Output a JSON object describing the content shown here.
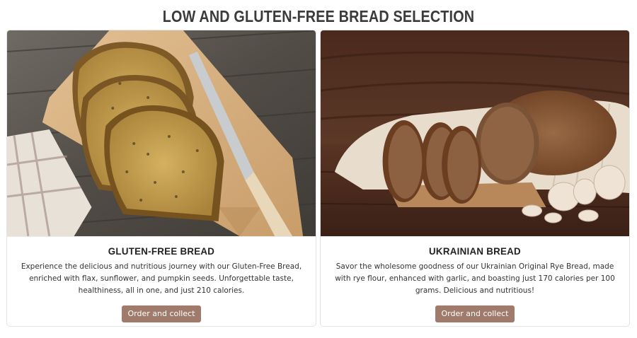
{
  "page": {
    "title": "LOW AND GLUTEN-FREE BREAD SELECTION"
  },
  "products": [
    {
      "name": "GLUTEN-FREE BREAD",
      "description": "Experience the delicious and nutritious journey with our Gluten-Free Bread, enriched with flax, sunflower, and pumpkin seeds. Unforgettable taste, healthiness, all in one, and just 210 calories.",
      "button_label": "Order and collect",
      "image_icon": "seeded-bread-on-board-photo"
    },
    {
      "name": "UKRAINIAN BREAD",
      "description": "Savor the wholesome goodness of our Ukrainian Original Rye Bread, made with rye flour, enhanced with garlic, and boasting just 170 calories per 100 grams. Delicious and nutritious!",
      "button_label": "Order and collect",
      "image_icon": "rye-bread-with-garlic-photo"
    }
  ],
  "colors": {
    "button_bg": "#a07b6c",
    "title_text": "#3b3b3b"
  }
}
